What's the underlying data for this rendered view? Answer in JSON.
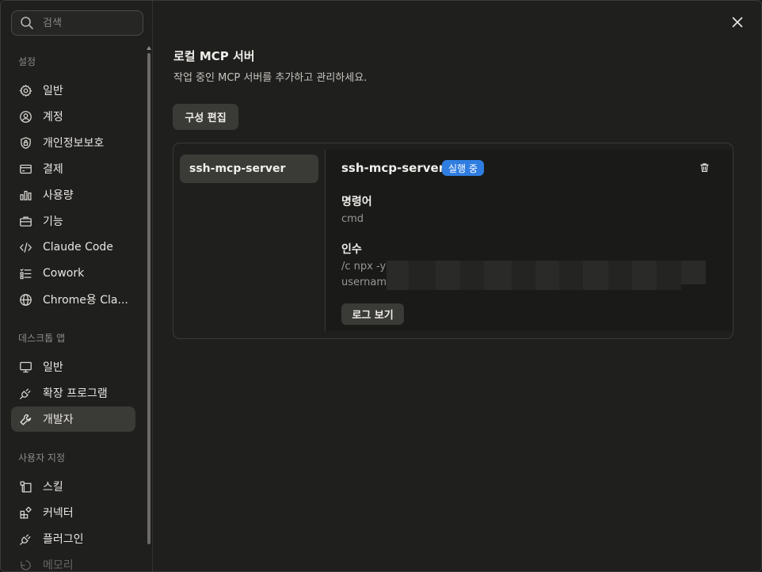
{
  "search": {
    "placeholder": "검색"
  },
  "sidebar": {
    "sections": [
      {
        "label": "설정",
        "items": [
          {
            "label": "일반",
            "icon": "gear-icon"
          },
          {
            "label": "계정",
            "icon": "user-circle-icon"
          },
          {
            "label": "개인정보보호",
            "icon": "shield-lock-icon"
          },
          {
            "label": "결제",
            "icon": "credit-card-icon"
          },
          {
            "label": "사용량",
            "icon": "bar-chart-icon"
          },
          {
            "label": "기능",
            "icon": "briefcase-icon"
          },
          {
            "label": "Claude Code",
            "icon": "code-icon"
          },
          {
            "label": "Cowork",
            "icon": "checklist-icon"
          },
          {
            "label": "Chrome용 Cla...",
            "icon": "globe-icon"
          }
        ]
      },
      {
        "label": "데스크톱 앱",
        "items": [
          {
            "label": "일반",
            "icon": "monitor-icon"
          },
          {
            "label": "확장 프로그램",
            "icon": "plug-icon"
          },
          {
            "label": "개발자",
            "icon": "wrench-icon",
            "active": true
          }
        ]
      },
      {
        "label": "사용자 지정",
        "items": [
          {
            "label": "스킬",
            "icon": "skill-icon"
          },
          {
            "label": "커넥터",
            "icon": "connector-icon"
          },
          {
            "label": "플러그인",
            "icon": "plug-icon"
          },
          {
            "label": "메모리",
            "icon": "memory-icon"
          }
        ]
      }
    ]
  },
  "main": {
    "title": "로컬 MCP 서버",
    "subtitle": "작업 중인 MCP 서버를 추가하고 관리하세요.",
    "edit_config_label": "구성 편집",
    "servers": [
      {
        "name": "ssh-mcp-server"
      }
    ],
    "detail": {
      "name": "ssh-mcp-server",
      "status": "실행 중",
      "status_color": "#2f7de1",
      "command_label": "명령어",
      "command_value": "cmd",
      "args_label": "인수",
      "args_line1": "/c npx -y",
      "args_line2": "usernam",
      "log_button": "로그 보기"
    }
  }
}
